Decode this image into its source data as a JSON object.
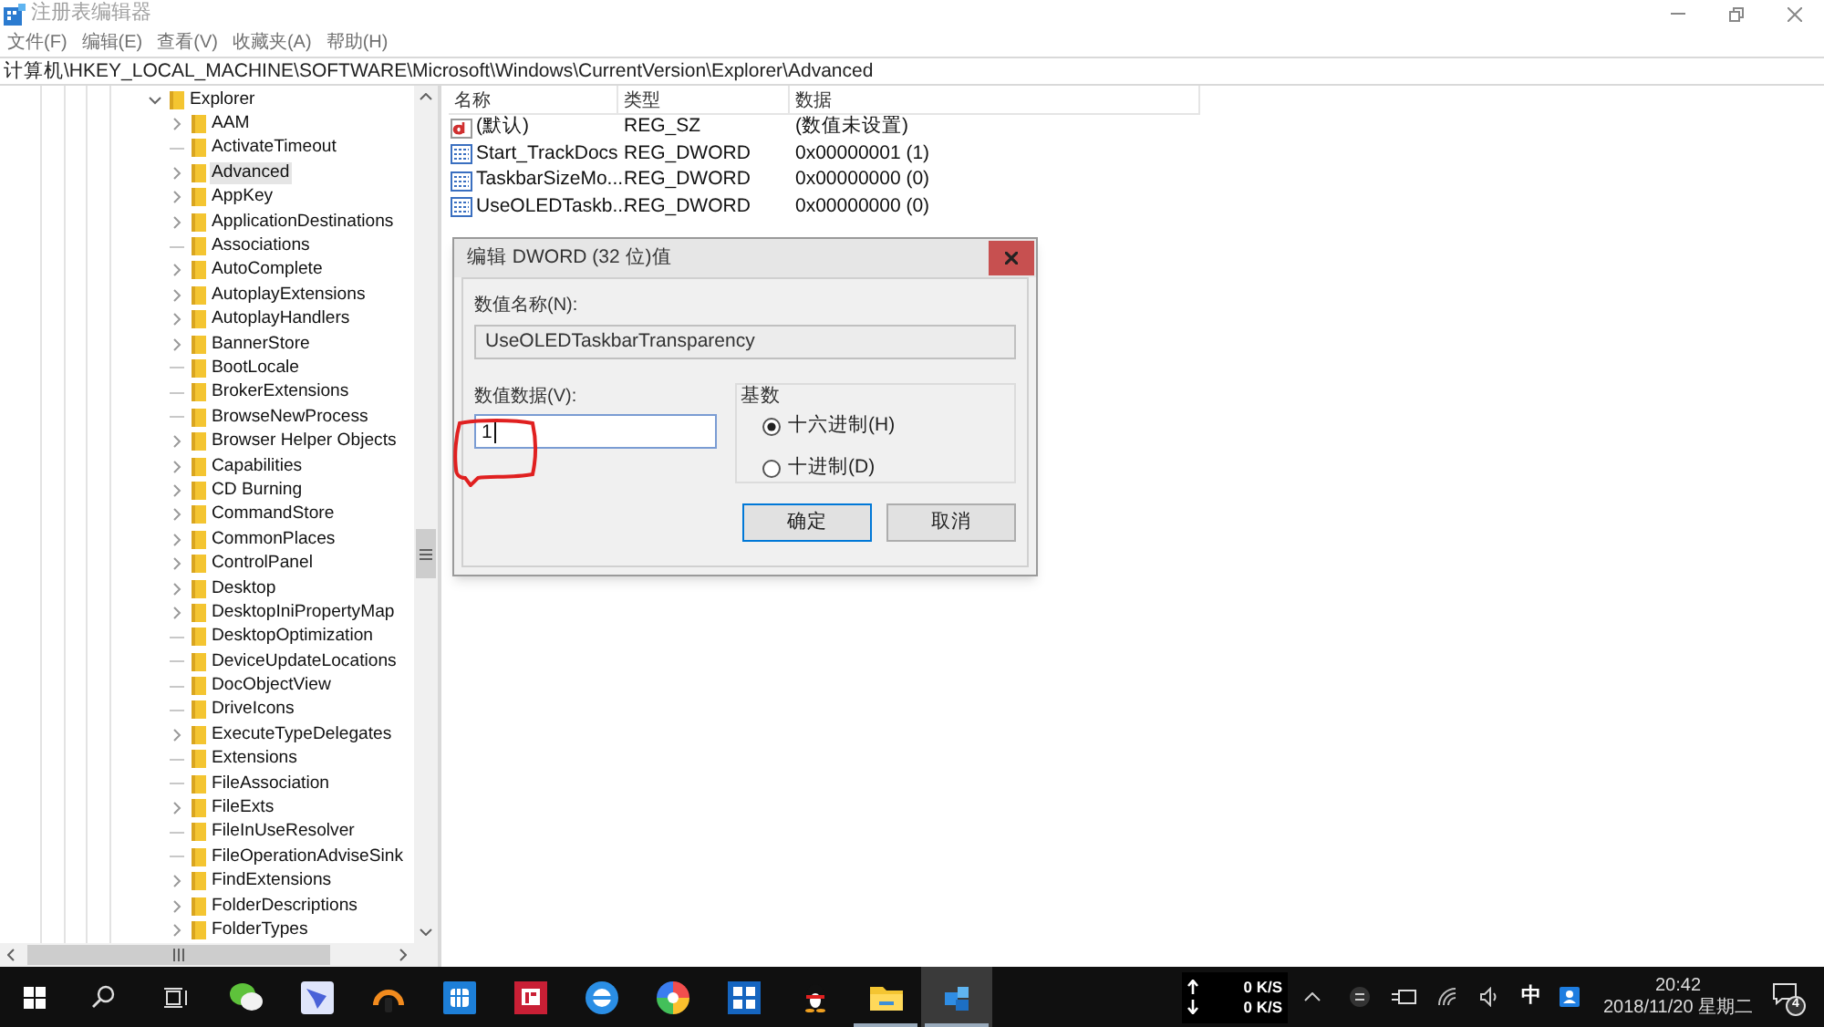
{
  "window": {
    "title": "注册表编辑器"
  },
  "menu": [
    "文件(F)",
    "编辑(E)",
    "查看(V)",
    "收藏夹(A)",
    "帮助(H)"
  ],
  "address": "计算机\\HKEY_LOCAL_MACHINE\\SOFTWARE\\Microsoft\\Windows\\CurrentVersion\\Explorer\\Advanced",
  "tree": [
    {
      "label": "Explorer",
      "expanded": true,
      "selected": false,
      "children": [
        {
          "label": "AAM",
          "expandable": true,
          "selected": false
        },
        {
          "label": "ActivateTimeout",
          "expandable": false,
          "selected": false
        },
        {
          "label": "Advanced",
          "expandable": true,
          "selected": true
        },
        {
          "label": "AppKey",
          "expandable": true,
          "selected": false
        },
        {
          "label": "ApplicationDestinations",
          "expandable": true,
          "selected": false
        },
        {
          "label": "Associations",
          "expandable": false,
          "selected": false
        },
        {
          "label": "AutoComplete",
          "expandable": true,
          "selected": false
        },
        {
          "label": "AutoplayExtensions",
          "expandable": true,
          "selected": false
        },
        {
          "label": "AutoplayHandlers",
          "expandable": true,
          "selected": false
        },
        {
          "label": "BannerStore",
          "expandable": true,
          "selected": false
        },
        {
          "label": "BootLocale",
          "expandable": false,
          "selected": false
        },
        {
          "label": "BrokerExtensions",
          "expandable": false,
          "selected": false
        },
        {
          "label": "BrowseNewProcess",
          "expandable": false,
          "selected": false
        },
        {
          "label": "Browser Helper Objects",
          "expandable": true,
          "selected": false
        },
        {
          "label": "Capabilities",
          "expandable": true,
          "selected": false
        },
        {
          "label": "CD Burning",
          "expandable": true,
          "selected": false
        },
        {
          "label": "CommandStore",
          "expandable": true,
          "selected": false
        },
        {
          "label": "CommonPlaces",
          "expandable": true,
          "selected": false
        },
        {
          "label": "ControlPanel",
          "expandable": true,
          "selected": false
        },
        {
          "label": "Desktop",
          "expandable": true,
          "selected": false
        },
        {
          "label": "DesktopIniPropertyMap",
          "expandable": true,
          "selected": false
        },
        {
          "label": "DesktopOptimization",
          "expandable": false,
          "selected": false
        },
        {
          "label": "DeviceUpdateLocations",
          "expandable": false,
          "selected": false
        },
        {
          "label": "DocObjectView",
          "expandable": false,
          "selected": false
        },
        {
          "label": "DriveIcons",
          "expandable": false,
          "selected": false
        },
        {
          "label": "ExecuteTypeDelegates",
          "expandable": true,
          "selected": false
        },
        {
          "label": "Extensions",
          "expandable": false,
          "selected": false
        },
        {
          "label": "FileAssociation",
          "expandable": false,
          "selected": false
        },
        {
          "label": "FileExts",
          "expandable": true,
          "selected": false
        },
        {
          "label": "FileInUseResolver",
          "expandable": false,
          "selected": false
        },
        {
          "label": "FileOperationAdviseSink",
          "expandable": false,
          "selected": false
        },
        {
          "label": "FindExtensions",
          "expandable": true,
          "selected": false
        },
        {
          "label": "FolderDescriptions",
          "expandable": true,
          "selected": false
        },
        {
          "label": "FolderTypes",
          "expandable": true,
          "selected": false
        }
      ]
    }
  ],
  "values_table": {
    "columns": [
      "名称",
      "类型",
      "数据"
    ],
    "rows": [
      {
        "kind": "string",
        "name": "(默认)",
        "type": "REG_SZ",
        "data": "(数值未设置)"
      },
      {
        "kind": "dword",
        "name": "Start_TrackDocs",
        "type": "REG_DWORD",
        "data": "0x00000001 (1)"
      },
      {
        "kind": "dword",
        "name": "TaskbarSizeMo...",
        "type": "REG_DWORD",
        "data": "0x00000000 (0)"
      },
      {
        "kind": "dword",
        "name": "UseOLEDTaskb...",
        "type": "REG_DWORD",
        "data": "0x00000000 (0)"
      }
    ]
  },
  "dialog": {
    "title": "编辑 DWORD (32 位)值",
    "name_label": "数值名称(N):",
    "name_value": "UseOLEDTaskbarTransparency",
    "data_label": "数值数据(V):",
    "data_value": "1",
    "base_label": "基数",
    "base_options": [
      {
        "label": "十六进制(H)",
        "selected": true
      },
      {
        "label": "十进制(D)",
        "selected": false
      }
    ],
    "buttons": [
      {
        "label": "确定",
        "focused": true
      },
      {
        "label": "取消",
        "focused": false
      }
    ]
  },
  "taskbar": {
    "apps": [
      {
        "kind": "wechat",
        "running": false,
        "selected": false
      },
      {
        "kind": "bird",
        "running": false,
        "selected": false
      },
      {
        "kind": "headphones",
        "running": false,
        "selected": false
      },
      {
        "kind": "cube",
        "running": false,
        "selected": false
      },
      {
        "kind": "redsquare",
        "running": false,
        "selected": false
      },
      {
        "kind": "browser",
        "running": false,
        "selected": false
      },
      {
        "kind": "ring",
        "running": false,
        "selected": false
      },
      {
        "kind": "grid",
        "running": false,
        "selected": false
      },
      {
        "kind": "penguin",
        "running": false,
        "selected": false
      },
      {
        "kind": "folder",
        "running": true,
        "selected": false
      },
      {
        "kind": "regedit",
        "running": true,
        "selected": true
      }
    ]
  },
  "tray": {
    "upload": "0 K/S",
    "download": "0 K/S",
    "ime": "中",
    "time": "20:42",
    "date": "2018/11/20 星期二",
    "notifications": "4"
  }
}
